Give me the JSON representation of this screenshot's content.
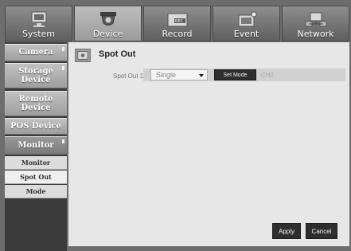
{
  "tabs": [
    {
      "label": "System",
      "icon": "monitor-icon",
      "active": false
    },
    {
      "label": "Device",
      "icon": "camera-device-icon",
      "active": true
    },
    {
      "label": "Record",
      "icon": "rec-icon",
      "active": false
    },
    {
      "label": "Event",
      "icon": "event-icon",
      "active": false
    },
    {
      "label": "Network",
      "icon": "network-icon",
      "active": false
    }
  ],
  "sidebar": {
    "items": [
      {
        "label": "Camera"
      },
      {
        "label": "Storage\nDevice"
      },
      {
        "label": "Remote\nDevice"
      },
      {
        "label": "POS Device"
      },
      {
        "label": "Monitor"
      }
    ],
    "subitems": [
      {
        "label": "Monitor"
      },
      {
        "label": "Spot Out"
      },
      {
        "label": "Mode"
      }
    ]
  },
  "page": {
    "title": "Spot Out",
    "spot_out_label": "Spot Out 1",
    "select_value": "Single",
    "set_mode_label": "Set Mode",
    "channel_text": "CH2",
    "apply_label": "Apply",
    "cancel_label": "Cancel"
  }
}
